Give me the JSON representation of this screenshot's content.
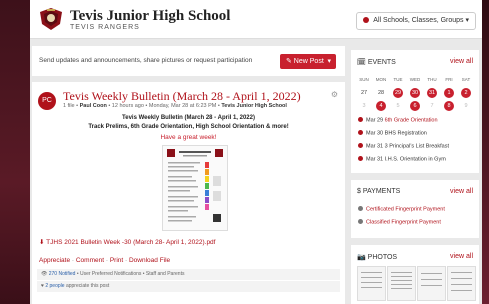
{
  "header": {
    "school_name": "Tevis Junior High School",
    "school_sub": "TEVIS RANGERS",
    "filter_label": "All Schools, Classes, Groups ▾"
  },
  "compose": {
    "prompt": "Send updates and announcements, share pictures or request participation",
    "new_post_label": "✎ New Post",
    "new_post_caret": "▾"
  },
  "post": {
    "avatar_initials": "PC",
    "title": "Tevis Weekly Bulletin (March 28 - April 1, 2022)",
    "meta_prefix": "1 file •",
    "author": "Paul Coon",
    "meta_suffix": "• 12 hours ago • Monday, Mar 28 at 6:23 PM •",
    "school": "Tevis Junior High School",
    "body_line1": "Tevis Weekly Bulletin (March 28 - April 1, 2022)",
    "body_line2": "Track Prelims, 6th Grade Orientation, High School Orientation & more!",
    "body_line3": "Have a great week!",
    "attachment": "TJHS 2021 Bulletin Week -30 (March 28- April 1, 2022).pdf",
    "actions": [
      "Appreciate",
      "Comment",
      "Print",
      "Download File"
    ],
    "notified_count": "270 Notified",
    "notified_detail": "• User Preferred Notifications • Staff and Parents",
    "appreciate_count": "2 people",
    "appreciate_detail": "appreciate this post"
  },
  "events": {
    "title": "EVENTS",
    "view_all": "view all",
    "day_names": [
      "SUN",
      "MON",
      "TUE",
      "WED",
      "THU",
      "FRI",
      "SAT"
    ],
    "week1": [
      "27",
      "28",
      "29",
      "30",
      "31",
      "1",
      "2"
    ],
    "week2": [
      "3",
      "4",
      "5",
      "6",
      "7",
      "8",
      "9"
    ],
    "items": [
      {
        "date": "Mar 29",
        "name": "6th Grade Orientation"
      },
      {
        "date": "Mar 30",
        "name": "BHS Registration"
      },
      {
        "date": "Mar 31",
        "name": "3 Principal's List Breakfast"
      },
      {
        "date": "Mar 31",
        "name": "I.H.S. Orientation in Gym"
      }
    ]
  },
  "payments": {
    "title": "PAYMENTS",
    "view_all": "view all",
    "items": [
      "Certificated Fingerprint Payment",
      "Classified Fingerprint Payment"
    ]
  },
  "photos": {
    "title": "PHOTOS",
    "view_all": "view all"
  },
  "colors": {
    "accent": "#b0121b",
    "button": "#c8202e",
    "background": "#e9e9e9"
  }
}
